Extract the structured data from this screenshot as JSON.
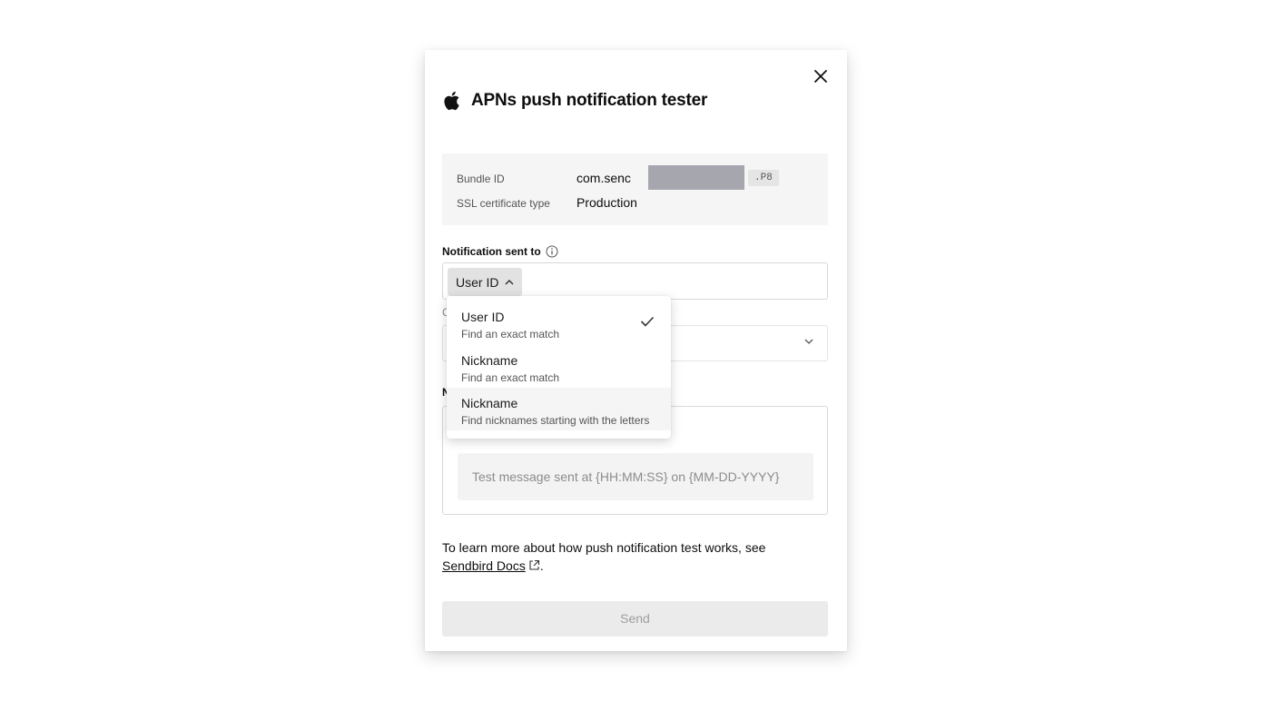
{
  "modal": {
    "title": "APNs push notification tester",
    "icon": "apple-icon"
  },
  "info": {
    "bundle_label": "Bundle ID",
    "bundle_value": "com.senc",
    "cert_badge": ".P8",
    "ssl_label": "SSL certificate type",
    "ssl_value": "Production"
  },
  "recipient": {
    "label": "Notification sent to",
    "selected_type": "User ID",
    "input_value": ""
  },
  "hidden_labels": {
    "channel_partial": "C",
    "message_partial": "N"
  },
  "dropdown": {
    "options": [
      {
        "title": "User ID",
        "subtitle": "Find an exact match",
        "selected": true
      },
      {
        "title": "Nickname",
        "subtitle": "Find an exact match",
        "selected": false
      },
      {
        "title": "Nickname",
        "subtitle": "Find nicknames starting with the letters",
        "selected": false
      }
    ]
  },
  "message": {
    "placeholder": "Test message sent at {HH:MM:SS} on {MM-DD-YYYY}"
  },
  "footer": {
    "learn_text": "To learn more about how push notification test works, see",
    "link_text": "Sendbird Docs",
    "trailing": ".",
    "send_label": "Send"
  },
  "colors": {
    "redaction": "#a6a6ae",
    "disabled_button": "#ebebeb",
    "info_box": "#f5f5f5"
  }
}
